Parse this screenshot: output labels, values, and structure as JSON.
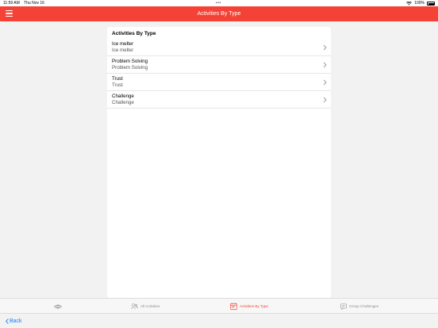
{
  "status_bar": {
    "time": "11:59 AM",
    "date": "Thu Nov 16",
    "battery": "100%"
  },
  "nav": {
    "title": "Activities By Type"
  },
  "card": {
    "title": "Activities By Type",
    "items": [
      {
        "title": "Ice melter",
        "subtitle": "Ice melter"
      },
      {
        "title": "Problem Solving",
        "subtitle": "Problem Solving"
      },
      {
        "title": "Trust",
        "subtitle": "Trust"
      },
      {
        "title": "Challenge",
        "subtitle": "Challenge"
      }
    ]
  },
  "tabs": [
    {
      "label": "",
      "icon": "eye-icon"
    },
    {
      "label": "All Activities",
      "icon": "people-icon"
    },
    {
      "label": "Activities By Type",
      "icon": "calendar-icon",
      "active": true
    },
    {
      "label": "Group Challenges",
      "icon": "chat-icon"
    }
  ],
  "back": {
    "label": "Back"
  },
  "colors": {
    "accent": "#f44336",
    "link": "#1a7cf0"
  }
}
